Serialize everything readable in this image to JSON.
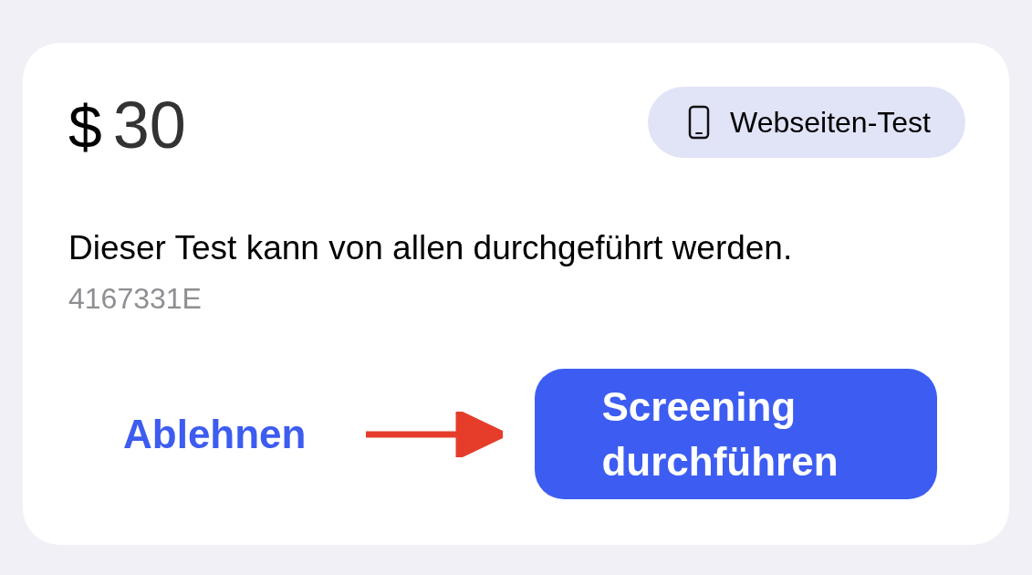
{
  "offer": {
    "currency": "$",
    "amount": "30",
    "badge": {
      "kind": "phone",
      "label": "Webseiten-Test"
    },
    "description": "Dieser Test kann von allen durchgeführt werden.",
    "test_id": "4167331E",
    "decline_button": "Ablehnen",
    "accept_button": "Screening durchführen"
  }
}
